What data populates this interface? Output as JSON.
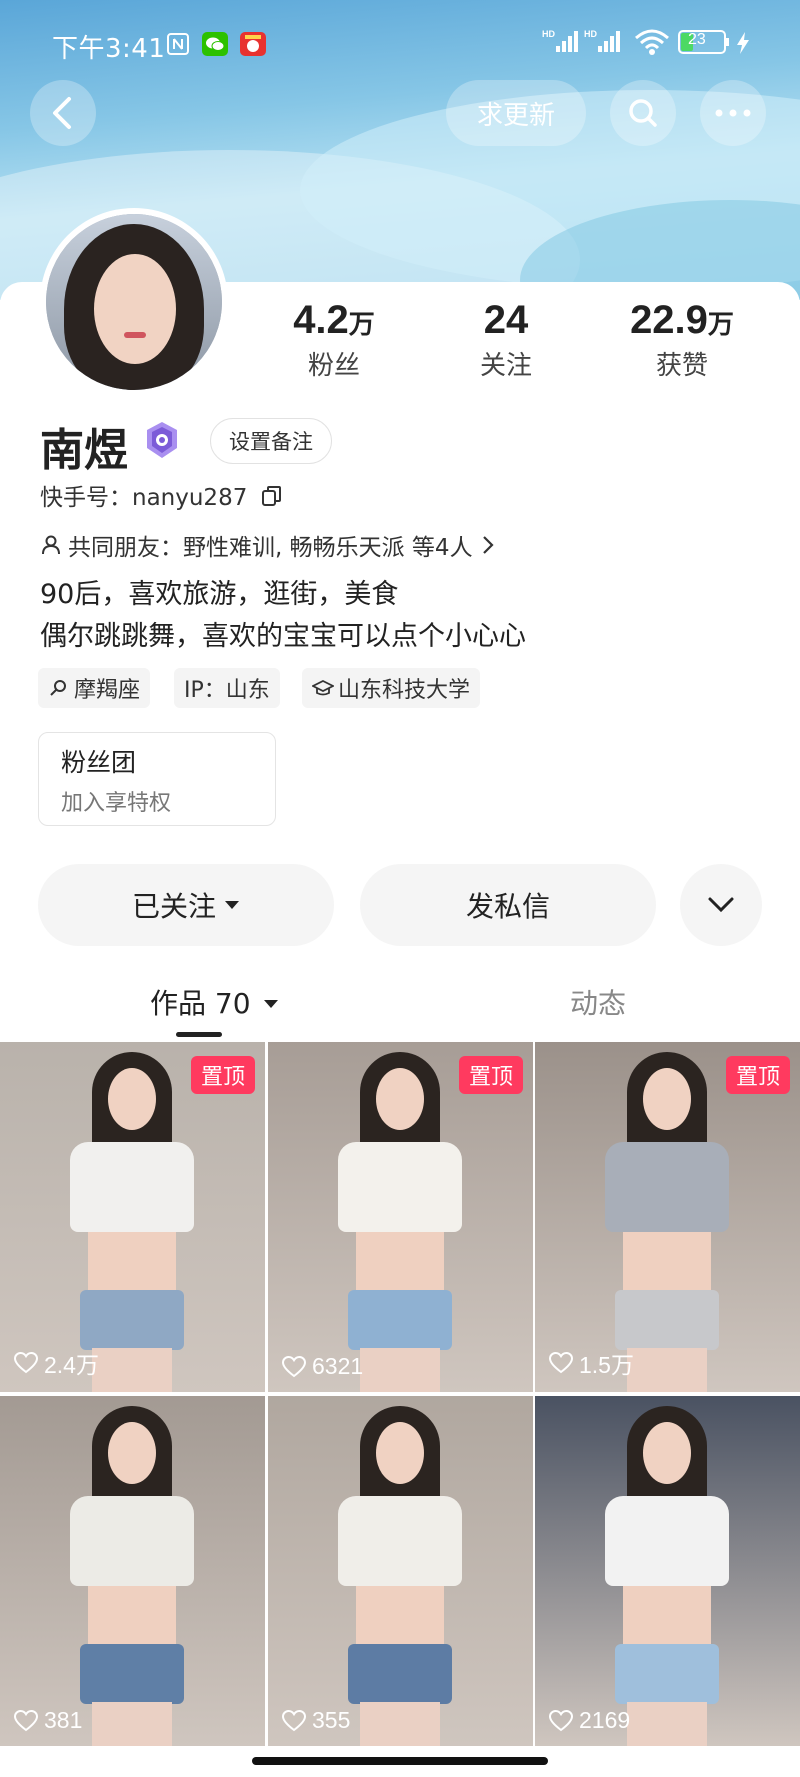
{
  "status_bar": {
    "time": "下午3:41",
    "battery": "23",
    "signal_1": "HD",
    "signal_2": "HD"
  },
  "top_actions": {
    "request_update": "求更新"
  },
  "stats": [
    {
      "num": "4.2",
      "unit": "万",
      "label": "粉丝"
    },
    {
      "num": "24",
      "unit": "",
      "label": "关注"
    },
    {
      "num": "22.9",
      "unit": "万",
      "label": "获赞"
    }
  ],
  "profile": {
    "name": "南煜",
    "remark_button": "设置备注",
    "kuaishou_id": "快手号：nanyu287",
    "mutual_friends": "共同朋友：野性难训, 畅畅乐天派 等4人",
    "bio_line1": "90后，喜欢旅游，逛街，美食",
    "bio_line2": "偶尔跳跳舞，喜欢的宝宝可以点个小心心"
  },
  "tags": [
    {
      "text": "摩羯座",
      "icon": "zodiac-icon"
    },
    {
      "text": "IP：山东",
      "icon": ""
    },
    {
      "text": "山东科技大学",
      "icon": "graduation-cap-icon"
    }
  ],
  "fan_club": {
    "title": "粉丝团",
    "subtitle": "加入享特权"
  },
  "actions": {
    "following": "已关注",
    "message": "发私信"
  },
  "tabs": {
    "works": "作品 70",
    "moments": "动态"
  },
  "videos": [
    {
      "likes": "2.4万",
      "pinned": true,
      "pin_label": "置顶",
      "top_color": "#b9b2ab",
      "outfit": "#f1f0ee",
      "shorts": "#8fa8c4"
    },
    {
      "likes": "6321",
      "pinned": true,
      "pin_label": "置顶",
      "top_color": "#a79d96",
      "outfit": "#f3f1ec",
      "shorts": "#8fb1d2"
    },
    {
      "likes": "1.5万",
      "pinned": true,
      "pin_label": "置顶",
      "top_color": "#9b918a",
      "outfit": "#a8aeb8",
      "shorts": "#c7c8cb"
    },
    {
      "likes": "381",
      "pinned": false,
      "pin_label": "",
      "top_color": "#a39a93",
      "outfit": "#ecebe6",
      "shorts": "#5f7fa6"
    },
    {
      "likes": "355",
      "pinned": false,
      "pin_label": "",
      "top_color": "#b0a79f",
      "outfit": "#f0eee9",
      "shorts": "#5d7ca4"
    },
    {
      "likes": "2169",
      "pinned": false,
      "pin_label": "",
      "top_color": "#4a5262",
      "outfit": "#f2f2f2",
      "shorts": "#9fbfdc"
    }
  ],
  "colors": {
    "pin_red": "#ff3a5f",
    "banner_blue": "#86c6e6"
  }
}
